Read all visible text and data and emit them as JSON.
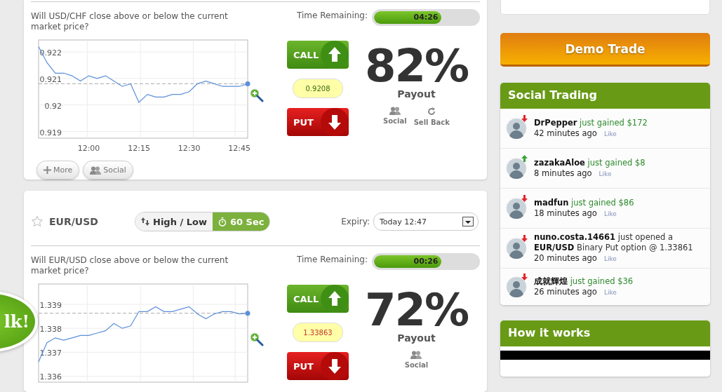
{
  "markets": [
    {
      "question": "Will USD/CHF close above or below the current market price?",
      "timer": {
        "label": "Time Remaining:",
        "value": "04:26",
        "level": 0.65
      },
      "chart_data": {
        "type": "line",
        "categories": [
          null,
          null,
          null,
          null,
          null,
          null,
          "12:00",
          null,
          null,
          null,
          null,
          null,
          "12:15",
          null,
          null,
          null,
          null,
          null,
          "12:30",
          null,
          null,
          null,
          null,
          null,
          "12:45",
          null
        ],
        "series": [
          {
            "color": "#5b8fd9",
            "values": [
              0.9222,
              0.9216,
              0.9212,
              0.9212,
              0.9211,
              0.9209,
              0.9211,
              0.921,
              0.9211,
              0.9209,
              0.9207,
              0.9208,
              0.9201,
              0.9204,
              0.9203,
              0.9203,
              0.9204,
              0.9204,
              0.9205,
              0.9208,
              0.9209,
              0.9208,
              0.9207,
              0.9207,
              0.9207,
              0.9208
            ]
          }
        ],
        "ylim": [
          0.91875,
          0.92245
        ],
        "yticks": [
          0.919,
          0.92,
          0.921,
          0.922
        ],
        "grid": true,
        "ref_lines": [
          {
            "axis": "y",
            "value": 0.9208
          }
        ]
      },
      "call_label": "CALL",
      "price": "0.9208",
      "price_rising": true,
      "put_label": "PUT",
      "payout": "82%",
      "payout_label": "Payout",
      "actions": [
        {
          "kind": "social",
          "label": "Social"
        },
        {
          "kind": "sellback",
          "label": "Sell Back"
        }
      ],
      "buttons": [
        {
          "kind": "more",
          "label": "More"
        },
        {
          "kind": "social",
          "label": "Social"
        }
      ]
    },
    {
      "header": {
        "symbol": "EUR/USD",
        "favorite": false,
        "modes": [
          {
            "kind": "highlow",
            "label": "High / Low",
            "selected": false
          },
          {
            "kind": "timer",
            "label": "60 Sec",
            "selected": true
          }
        ],
        "expiry_label": "Expiry:",
        "expiry_value": "Today 12:47"
      },
      "question": "Will EUR/USD close above or below the current market price?",
      "timer": {
        "label": "Time Remaining:",
        "value": "00:26",
        "level": 0.65
      },
      "chart_data": {
        "type": "line",
        "categories": [
          null,
          null,
          null,
          null,
          null,
          null,
          null,
          null,
          null,
          null,
          null,
          null,
          null,
          null,
          null,
          null,
          null,
          null,
          null,
          null,
          null,
          null,
          null,
          null,
          null,
          null
        ],
        "series": [
          {
            "color": "#5b8fd9",
            "values": [
              1.3366,
              1.3374,
              1.3376,
              1.3375,
              1.3376,
              1.3377,
              1.3377,
              1.3378,
              1.3379,
              1.3382,
              1.338,
              1.3381,
              1.3387,
              1.3387,
              1.3389,
              1.3387,
              1.3387,
              1.3388,
              1.3389,
              1.3386,
              1.3384,
              1.3386,
              1.3387,
              1.3387,
              1.3386,
              1.33863
            ]
          }
        ],
        "ylim": [
          1.33575,
          1.33985
        ],
        "yticks": [
          1.336,
          1.337,
          1.338,
          1.339
        ],
        "grid": true,
        "ref_lines": [
          {
            "axis": "y",
            "value": 1.33863
          }
        ]
      },
      "call_label": "CALL",
      "price": "1.33863",
      "price_rising": false,
      "put_label": "PUT",
      "payout": "72%",
      "payout_label": "Payout",
      "actions": [
        {
          "kind": "social",
          "label": "Social"
        }
      ]
    }
  ],
  "chat_bubble": {
    "text": "lk!"
  },
  "sidebar": {
    "demo_button": "Demo Trade",
    "social_trading": {
      "title": "Social Trading",
      "items": [
        {
          "user": "DrPepper",
          "text": "just gained $172",
          "kind": "gain",
          "rising": false,
          "time": "42 minutes ago",
          "like": "Like"
        },
        {
          "user": "zazakaAloe",
          "text": "just gained $8",
          "kind": "gain",
          "rising": true,
          "time": "8 minutes ago",
          "like": "Like"
        },
        {
          "user": "madfun",
          "text": "just gained $86",
          "kind": "gain",
          "rising": false,
          "time": "18 minutes ago",
          "like": "Like"
        },
        {
          "user": "nuno.costa.14661",
          "text": "just opened a **EUR/USD** Binary Put option @ 1.33861",
          "kind": "open",
          "rising": false,
          "time": "20 minutes ago",
          "like": "Like"
        },
        {
          "user": "成就輝煌",
          "text": "just gained $36",
          "kind": "gain",
          "rising": false,
          "time": "26 minutes ago",
          "like": "Like"
        }
      ]
    },
    "how_it_works": {
      "title": "How it works"
    }
  }
}
